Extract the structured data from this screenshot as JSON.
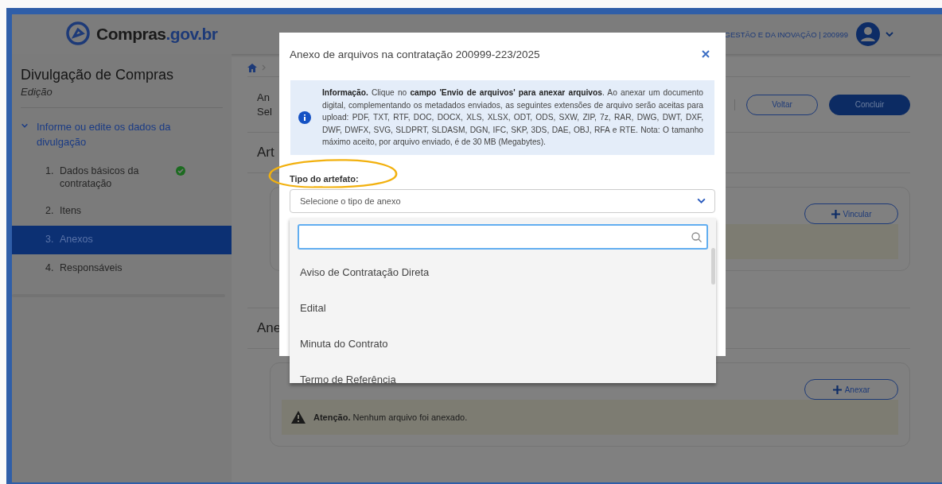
{
  "header": {
    "logo": {
      "name": "Compras",
      "domain": ".gov.br"
    },
    "organization": "GESTÃO E DA INOVAÇÃO | 200999"
  },
  "sidebar": {
    "title": "Divulgação de Compras",
    "subtitle": "Edição",
    "section": {
      "label": "Informe ou edite os dados da divulgação",
      "expanded": true
    },
    "steps": [
      {
        "number": "1.",
        "label": "Dados básicos da contratação",
        "completed": true,
        "selected": false
      },
      {
        "number": "2.",
        "label": "Itens",
        "completed": false,
        "selected": false
      },
      {
        "number": "3.",
        "label": "Anexos",
        "completed": false,
        "selected": true
      },
      {
        "number": "4.",
        "label": "Responsáveis",
        "completed": false,
        "selected": false
      }
    ]
  },
  "main": {
    "heading_line_1": "An",
    "heading_line_2": "Sel",
    "buttons": [
      "Voltar",
      "Concluir"
    ],
    "sections": [
      {
        "title": "Art",
        "button": "Vincular"
      },
      {
        "title": "Ane",
        "button": "Anexar",
        "alert": "**Atenção.** Nenhum arquivo foi anexado."
      }
    ]
  },
  "modal": {
    "title": "Anexo de arquivos na contratação 200999-223/2025",
    "info": "**Informação.** Clique no **campo 'Envio de arquivos' para anexar arquivos**. Ao anexar um documento digital, complementando os metadados enviados, as seguintes extensões de arquivo serão aceitas para upload: PDF, TXT, RTF, DOC, DOCX, XLS, XLSX, ODT, ODS, SXW, ZIP, 7z, RAR, DWG, DWT, DXF, DWF, DWFX, SVG, SLDPRT, SLDASM, DGN, IFC, SKP, 3DS, DAE, OBJ, RFA e RTE. Nota: O tamanho máximo aceito, por arquivo enviado, é de 30 MB (Megabytes).",
    "field_label": "Tipo do artefato:",
    "select": {
      "placeholder": "Selecione o tipo de anexo",
      "expanded": true
    },
    "options": [
      "Aviso de Contratação Direta",
      "Edital",
      "Minuta do Contrato",
      "Termo de Referência"
    ]
  }
}
